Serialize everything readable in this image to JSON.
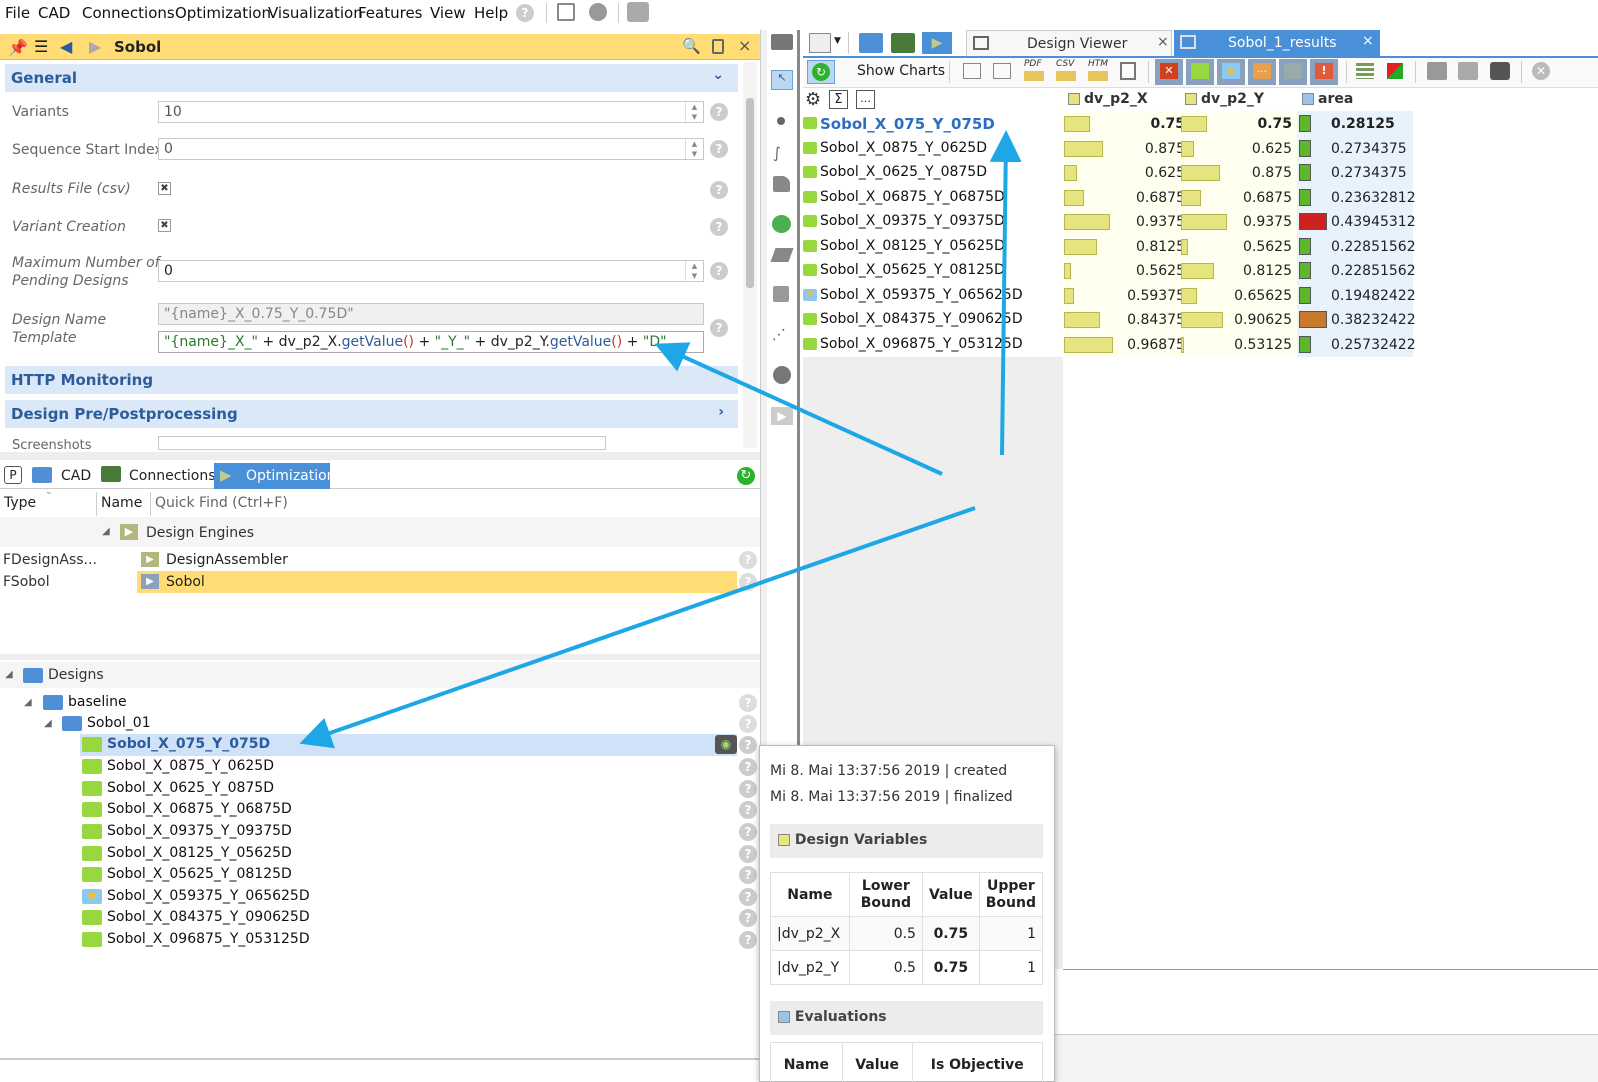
{
  "menu": [
    "File",
    "CAD",
    "Connections",
    "Optimization",
    "Visualization",
    "Features",
    "View",
    "Help"
  ],
  "panel_title": "Sobol",
  "sections": {
    "general": "General",
    "http": "HTTP Monitoring",
    "prepost": "Design Pre/Postprocessing"
  },
  "properties": {
    "variants_label": "Variants",
    "variants_value": "10",
    "seq_label": "Sequence Start Index",
    "seq_value": "0",
    "results_label": "Results File (csv)",
    "variant_creation_label": "Variant Creation",
    "max_pending_label1": "Maximum Number of",
    "max_pending_label2": "Pending Designs",
    "max_pending_value": "0",
    "dname_label1": "Design Name",
    "dname_label2": "Template",
    "dname_preview": "\"{name}_X_0.75_Y_0.75D\"",
    "dname_expr": {
      "p1": "\"{name}_X_\"",
      "p2": " + dv_p2_X.",
      "p3": "getValue",
      "p4": "()",
      "p5": " + ",
      "p6": "\"_Y_\"",
      "p7": " + dv_p2_Y.",
      "p8": "getValue",
      "p9": "()",
      "p10": " + ",
      "p11": "\"D\""
    },
    "screenshots_label": "Screenshots"
  },
  "bottom_tabs": {
    "p": "P",
    "cad": "CAD",
    "connections": "Connections",
    "optimization": "Optimization"
  },
  "tree_header": {
    "type": "Type",
    "name": "Name",
    "quickfind": "Quick Find (Ctrl+F)"
  },
  "engines": {
    "group": "Design Engines",
    "items": [
      {
        "type": "FDesignAss...",
        "name": "DesignAssembler"
      },
      {
        "type": "FSobol",
        "name": "Sobol"
      }
    ]
  },
  "designs": {
    "root": "Designs",
    "baseline": "baseline",
    "folder": "Sobol_01",
    "items": [
      "Sobol_X_075_Y_075D",
      "Sobol_X_0875_Y_0625D",
      "Sobol_X_0625_Y_0875D",
      "Sobol_X_06875_Y_06875D",
      "Sobol_X_09375_Y_09375D",
      "Sobol_X_08125_Y_05625D",
      "Sobol_X_05625_Y_08125D",
      "Sobol_X_059375_Y_065625D",
      "Sobol_X_084375_Y_090625D",
      "Sobol_X_096875_Y_053125D"
    ]
  },
  "right_tabs": {
    "viewer": "Design Viewer",
    "results": "Sobol_1_results"
  },
  "toolbar": {
    "show_charts": "Show Charts",
    "pdf": "PDF",
    "csv": "CSV",
    "htm": "HTM"
  },
  "results": {
    "columns": [
      "dv_p2_X",
      "dv_p2_Y",
      "area"
    ],
    "rows": [
      {
        "name": "Sobol_X_075_Y_075D",
        "x": "0.75",
        "y": "0.75",
        "area": "0.28125",
        "status": "green",
        "selected": true
      },
      {
        "name": "Sobol_X_0875_Y_0625D",
        "x": "0.875",
        "y": "0.625",
        "area": "0.2734375",
        "status": "green"
      },
      {
        "name": "Sobol_X_0625_Y_0875D",
        "x": "0.625",
        "y": "0.875",
        "area": "0.2734375",
        "status": "green"
      },
      {
        "name": "Sobol_X_06875_Y_06875D",
        "x": "0.6875",
        "y": "0.6875",
        "area": "0.23632812",
        "status": "green"
      },
      {
        "name": "Sobol_X_09375_Y_09375D",
        "x": "0.9375",
        "y": "0.9375",
        "area": "0.43945312",
        "status": "red"
      },
      {
        "name": "Sobol_X_08125_Y_05625D",
        "x": "0.8125",
        "y": "0.5625",
        "area": "0.22851562",
        "status": "green"
      },
      {
        "name": "Sobol_X_05625_Y_08125D",
        "x": "0.5625",
        "y": "0.8125",
        "area": "0.22851562",
        "status": "green"
      },
      {
        "name": "Sobol_X_059375_Y_065625D",
        "x": "0.59375",
        "y": "0.65625",
        "area": "0.19482422",
        "status": "green"
      },
      {
        "name": "Sobol_X_084375_Y_090625D",
        "x": "0.84375",
        "y": "0.90625",
        "area": "0.38232422",
        "status": "orange"
      },
      {
        "name": "Sobol_X_096875_Y_053125D",
        "x": "0.96875",
        "y": "0.53125",
        "area": "0.25732422",
        "status": "green"
      }
    ]
  },
  "popup": {
    "created": "Mi 8. Mai 13:37:56 2019 | created",
    "finalized": "Mi 8. Mai 13:37:56 2019 | finalized",
    "design_variables_title": "Design Variables",
    "headers": {
      "name": "Name",
      "lower1": "Lower",
      "lower2": "Bound",
      "value": "Value",
      "upper1": "Upper",
      "upper2": "Bound"
    },
    "vars": [
      {
        "name": "|dv_p2_X",
        "lower": "0.5",
        "value": "0.75",
        "upper": "1"
      },
      {
        "name": "|dv_p2_Y",
        "lower": "0.5",
        "value": "0.75",
        "upper": "1"
      }
    ],
    "evaluations_title": "Evaluations",
    "eval_headers": {
      "name": "Name",
      "value": "Value",
      "objective": "Is Objective"
    }
  },
  "colors": {
    "accent": "#ffdd74",
    "section": "#dbe8f7",
    "selected_tab": "#4a90d9",
    "bar_yellow": "#e6e47e",
    "status_green": "#5cb82a",
    "status_red": "#cc2222",
    "status_orange": "#c87a2a",
    "arrow": "#1ea7e6"
  }
}
